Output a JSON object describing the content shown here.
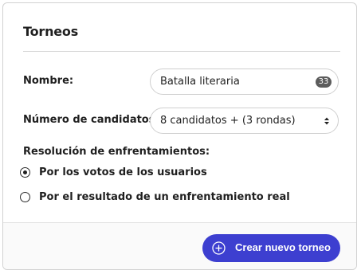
{
  "form": {
    "title": "Torneos",
    "name_field": {
      "label": "Nombre:",
      "value": "Batalla literaria",
      "char_count": "33"
    },
    "candidates_field": {
      "label": "Número de candidatos:",
      "selected": "8 candidatos + (3 rondas)"
    },
    "resolution": {
      "label": "Resolución de enfrentamientos:",
      "options": [
        {
          "label": "Por los votos de los usuarios",
          "selected": true
        },
        {
          "label": "Por el resultado de un enfrentamiento real",
          "selected": false
        }
      ]
    },
    "create_button": {
      "label": "Crear nuevo torneo",
      "icon": "plus-circle-icon"
    }
  },
  "colors": {
    "accent": "#3d3fd0",
    "badge": "#5c5c5c",
    "border": "#cfcfcf",
    "text": "#1f1f1f"
  }
}
